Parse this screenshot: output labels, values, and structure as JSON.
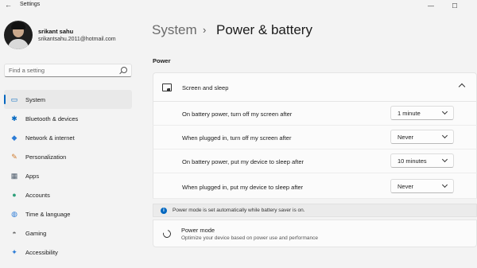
{
  "app": {
    "title": "Settings",
    "back_glyph": "←"
  },
  "window_controls": {
    "minimize": "—",
    "maximize": "☐"
  },
  "user": {
    "name": "srikant sahu",
    "email": "srikantsahu.2011@hotmail.com"
  },
  "search": {
    "placeholder": "Find a setting",
    "icon": "search-icon"
  },
  "nav": [
    {
      "label": "System",
      "icon": "laptop-icon",
      "glyph": "▭",
      "color": "#0067c0",
      "active": true
    },
    {
      "label": "Bluetooth & devices",
      "icon": "bluetooth-icon",
      "glyph": "✱",
      "color": "#0067c0"
    },
    {
      "label": "Network & internet",
      "icon": "wifi-icon",
      "glyph": "◆",
      "color": "#2c7cd6"
    },
    {
      "label": "Personalization",
      "icon": "brush-icon",
      "glyph": "✎",
      "color": "#d07b2e"
    },
    {
      "label": "Apps",
      "icon": "apps-icon",
      "glyph": "▦",
      "color": "#4d5b6b"
    },
    {
      "label": "Accounts",
      "icon": "person-icon",
      "glyph": "●",
      "color": "#2ea07a"
    },
    {
      "label": "Time & language",
      "icon": "globe-icon",
      "glyph": "◍",
      "color": "#2c7cd6"
    },
    {
      "label": "Gaming",
      "icon": "gamepad-icon",
      "glyph": "◓",
      "color": "#6b6b6b"
    },
    {
      "label": "Accessibility",
      "icon": "accessibility-icon",
      "glyph": "✦",
      "color": "#2c7cd6"
    }
  ],
  "breadcrumb": {
    "parent": "System",
    "separator": "›",
    "current": "Power & battery"
  },
  "section": {
    "title": "Power"
  },
  "screen_sleep": {
    "label": "Screen and sleep",
    "rows": [
      {
        "label": "On battery power, turn off my screen after",
        "value": "1 minute"
      },
      {
        "label": "When plugged in, turn off my screen after",
        "value": "Never"
      },
      {
        "label": "On battery power, put my device to sleep after",
        "value": "10 minutes"
      },
      {
        "label": "When plugged in, put my device to sleep after",
        "value": "Never"
      }
    ]
  },
  "info": {
    "text": "Power mode is set automatically while battery saver is on.",
    "icon_text": "i"
  },
  "power_mode": {
    "title": "Power mode",
    "subtitle": "Optimize your device based on power use and performance"
  },
  "colors": {
    "accent": "#0067c0",
    "background": "#f3f3f3",
    "card": "#fbfbfb"
  }
}
